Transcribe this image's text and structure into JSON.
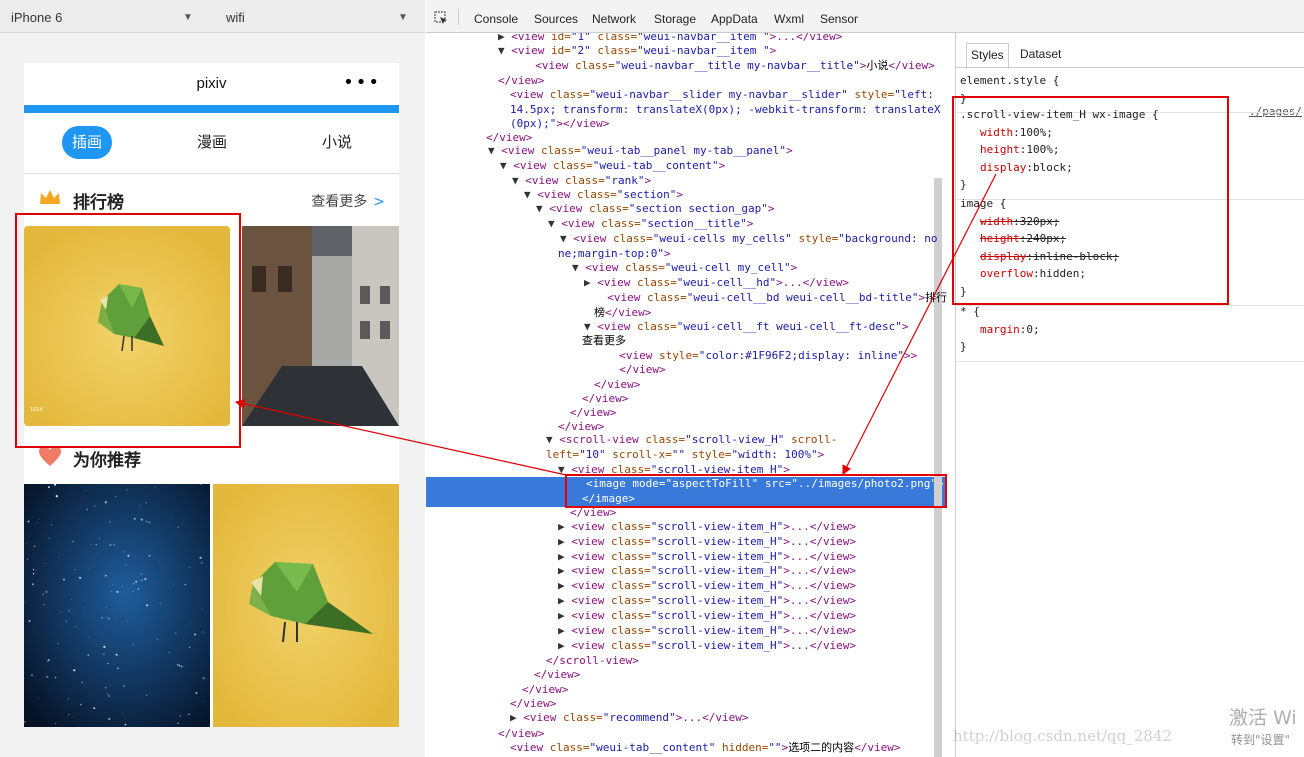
{
  "simulator": {
    "device": "iPhone 6",
    "network": "wifi"
  },
  "phone": {
    "nav_title": "pixiv",
    "menu_dots": "•••",
    "tabs": [
      "插画",
      "漫画",
      "小说"
    ],
    "active_tab": 0,
    "rank_title": "排行榜",
    "more": "查看更多",
    "more_arrow": ">",
    "recommend_title": "为你推荐",
    "accent": "#1F96F2",
    "crown_color": "#F5A623",
    "heart_color": "#F07C68",
    "tile_yellow": "#E6BE45",
    "tile_caption_small": "1024"
  },
  "devtools": {
    "tabs": [
      "Console",
      "Sources",
      "Network",
      "Storage",
      "AppData",
      "Wxml",
      "Sensor"
    ],
    "inspect_icon": "cursor-select-icon",
    "styles_tabs": [
      "Styles",
      "Dataset"
    ],
    "styles_active": 0,
    "source_link": "./pages/",
    "elements": [
      [
        {
          "t": "tri",
          "v": "▶ "
        },
        {
          "t": "tag",
          "v": "<view "
        },
        {
          "t": "an",
          "v": "id="
        },
        {
          "t": "av",
          "v": "\"1\" "
        },
        {
          "t": "an",
          "v": "class="
        },
        {
          "t": "av",
          "v": "\"weui-navbar__item \""
        },
        {
          "t": "tag",
          "v": ">...</view>"
        }
      ],
      [
        {
          "t": "tri",
          "v": "▼ "
        },
        {
          "t": "tag",
          "v": "<view "
        },
        {
          "t": "an",
          "v": "id="
        },
        {
          "t": "av",
          "v": "\"2\" "
        },
        {
          "t": "an",
          "v": "class="
        },
        {
          "t": "av",
          "v": "\"weui-navbar__item \""
        },
        {
          "t": "tag",
          "v": ">"
        }
      ],
      [
        {
          "t": "tag",
          "v": "  <view "
        },
        {
          "t": "an",
          "v": "class="
        },
        {
          "t": "av",
          "v": "\"weui-navbar__title my-navbar__title\""
        },
        {
          "t": "tag",
          "v": ">"
        },
        {
          "t": "tx",
          "v": "小说"
        },
        {
          "t": "tag",
          "v": "</view>"
        }
      ],
      [
        {
          "t": "tag",
          "v": "</view>"
        }
      ],
      [
        {
          "t": "tag",
          "v": "<view "
        },
        {
          "t": "an",
          "v": "class="
        },
        {
          "t": "av",
          "v": "\"weui-navbar__slider my-navbar__slider\" "
        },
        {
          "t": "an",
          "v": "style="
        },
        {
          "t": "av",
          "v": "\"left:"
        }
      ],
      [
        {
          "t": "av",
          "v": "14.5px; transform: translateX(0px); -webkit-transform: translateX"
        }
      ],
      [
        {
          "t": "av",
          "v": "(0px);\""
        },
        {
          "t": "tag",
          "v": "></view>"
        }
      ],
      [
        {
          "t": "tag",
          "v": "</view>"
        }
      ],
      [
        {
          "t": "tri",
          "v": "▼ "
        },
        {
          "t": "tag",
          "v": "<view "
        },
        {
          "t": "an",
          "v": "class="
        },
        {
          "t": "av",
          "v": "\"weui-tab__panel my-tab__panel\""
        },
        {
          "t": "tag",
          "v": ">"
        }
      ],
      [
        {
          "t": "tri",
          "v": "▼ "
        },
        {
          "t": "tag",
          "v": "<view "
        },
        {
          "t": "an",
          "v": "class="
        },
        {
          "t": "av",
          "v": "\"weui-tab__content\""
        },
        {
          "t": "tag",
          "v": ">"
        }
      ],
      [
        {
          "t": "tri",
          "v": "▼ "
        },
        {
          "t": "tag",
          "v": "<view "
        },
        {
          "t": "an",
          "v": "class="
        },
        {
          "t": "av",
          "v": "\"rank\""
        },
        {
          "t": "tag",
          "v": ">"
        }
      ],
      [
        {
          "t": "tri",
          "v": "▼ "
        },
        {
          "t": "tag",
          "v": "<view "
        },
        {
          "t": "an",
          "v": "class="
        },
        {
          "t": "av",
          "v": "\"section\""
        },
        {
          "t": "tag",
          "v": ">"
        }
      ],
      [
        {
          "t": "tri",
          "v": "▼ "
        },
        {
          "t": "tag",
          "v": "<view "
        },
        {
          "t": "an",
          "v": "class="
        },
        {
          "t": "av",
          "v": "\"section section_gap\""
        },
        {
          "t": "tag",
          "v": ">"
        }
      ],
      [
        {
          "t": "tri",
          "v": "▼ "
        },
        {
          "t": "tag",
          "v": "<view "
        },
        {
          "t": "an",
          "v": "class="
        },
        {
          "t": "av",
          "v": "\"section__title\""
        },
        {
          "t": "tag",
          "v": ">"
        }
      ],
      [
        {
          "t": "tri",
          "v": "▼ "
        },
        {
          "t": "tag",
          "v": "<view "
        },
        {
          "t": "an",
          "v": "class="
        },
        {
          "t": "av",
          "v": "\"weui-cells my_cells\" "
        },
        {
          "t": "an",
          "v": "style="
        },
        {
          "t": "av",
          "v": "\"background: no"
        }
      ],
      [
        {
          "t": "av",
          "v": "ne;margin-top:0\""
        },
        {
          "t": "tag",
          "v": ">"
        }
      ],
      [
        {
          "t": "tri",
          "v": "▼ "
        },
        {
          "t": "tag",
          "v": "<view "
        },
        {
          "t": "an",
          "v": "class="
        },
        {
          "t": "av",
          "v": "\"weui-cell my_cell\""
        },
        {
          "t": "tag",
          "v": ">"
        }
      ],
      [
        {
          "t": "tri",
          "v": "▶ "
        },
        {
          "t": "tag",
          "v": "<view "
        },
        {
          "t": "an",
          "v": "class="
        },
        {
          "t": "av",
          "v": "\"weui-cell__hd\""
        },
        {
          "t": "tag",
          "v": ">...</view>"
        }
      ],
      [
        {
          "t": "tag",
          "v": "  <view "
        },
        {
          "t": "an",
          "v": "class="
        },
        {
          "t": "av",
          "v": "\"weui-cell__bd weui-cell__bd-title\""
        },
        {
          "t": "tag",
          "v": ">"
        },
        {
          "t": "tx",
          "v": "排行"
        }
      ],
      [
        {
          "t": "tx",
          "v": "榜"
        },
        {
          "t": "tag",
          "v": "</view>"
        }
      ],
      [
        {
          "t": "tri",
          "v": "▼ "
        },
        {
          "t": "tag",
          "v": "<view "
        },
        {
          "t": "an",
          "v": "class="
        },
        {
          "t": "av",
          "v": "\"weui-cell__ft weui-cell__ft-desc\""
        },
        {
          "t": "tag",
          "v": ">"
        }
      ],
      [
        {
          "t": "tx",
          "v": "查看更多"
        }
      ],
      [
        {
          "t": "tag",
          "v": "  <view "
        },
        {
          "t": "an",
          "v": "style="
        },
        {
          "t": "av",
          "v": "\"color:#1F96F2;display: inline\""
        },
        {
          "t": "tag",
          "v": ">>"
        }
      ],
      [
        {
          "t": "tag",
          "v": "  </view>"
        }
      ],
      [
        {
          "t": "tag",
          "v": "</view>"
        }
      ],
      [
        {
          "t": "tag",
          "v": "</view>"
        }
      ],
      [
        {
          "t": "tag",
          "v": "</view>"
        }
      ],
      [
        {
          "t": "tag",
          "v": "</view>"
        }
      ],
      [
        {
          "t": "tri",
          "v": "▼ "
        },
        {
          "t": "tag",
          "v": "<scroll-view "
        },
        {
          "t": "an",
          "v": "class="
        },
        {
          "t": "av",
          "v": "\"scroll-view_H\" "
        },
        {
          "t": "an",
          "v": "scroll-"
        }
      ],
      [
        {
          "t": "an",
          "v": "left="
        },
        {
          "t": "av",
          "v": "\"10\" "
        },
        {
          "t": "an",
          "v": "scroll-x="
        },
        {
          "t": "av",
          "v": "\"\" "
        },
        {
          "t": "an",
          "v": "style="
        },
        {
          "t": "av",
          "v": "\"width: 100%\""
        },
        {
          "t": "tag",
          "v": ">"
        }
      ],
      [
        {
          "t": "tri",
          "v": "▼ "
        },
        {
          "t": "tag",
          "v": "<view "
        },
        {
          "t": "an",
          "v": "class="
        },
        {
          "t": "av",
          "v": "\"scroll-view-item_H\""
        },
        {
          "t": "tag",
          "v": ">"
        }
      ],
      [
        {
          "t": "tag",
          "v": "<image "
        },
        {
          "t": "an",
          "v": "mode="
        },
        {
          "t": "av",
          "v": "\"aspectToFill\" "
        },
        {
          "t": "an",
          "v": "src="
        },
        {
          "t": "av",
          "v": "\"../images/photo2.png\""
        },
        {
          "t": "tag",
          "v": ">"
        }
      ],
      [
        {
          "t": "tag",
          "v": "</image>"
        }
      ],
      [
        {
          "t": "tag",
          "v": "</view>"
        }
      ],
      [
        {
          "t": "tri",
          "v": "▶ "
        },
        {
          "t": "tag",
          "v": "<view "
        },
        {
          "t": "an",
          "v": "class="
        },
        {
          "t": "av",
          "v": "\"scroll-view-item_H\""
        },
        {
          "t": "tag",
          "v": ">...</view>"
        }
      ],
      [
        {
          "t": "tri",
          "v": "▶ "
        },
        {
          "t": "tag",
          "v": "<view "
        },
        {
          "t": "an",
          "v": "class="
        },
        {
          "t": "av",
          "v": "\"scroll-view-item_H\""
        },
        {
          "t": "tag",
          "v": ">...</view>"
        }
      ],
      [
        {
          "t": "tri",
          "v": "▶ "
        },
        {
          "t": "tag",
          "v": "<view "
        },
        {
          "t": "an",
          "v": "class="
        },
        {
          "t": "av",
          "v": "\"scroll-view-item_H\""
        },
        {
          "t": "tag",
          "v": ">...</view>"
        }
      ],
      [
        {
          "t": "tri",
          "v": "▶ "
        },
        {
          "t": "tag",
          "v": "<view "
        },
        {
          "t": "an",
          "v": "class="
        },
        {
          "t": "av",
          "v": "\"scroll-view-item_H\""
        },
        {
          "t": "tag",
          "v": ">...</view>"
        }
      ],
      [
        {
          "t": "tri",
          "v": "▶ "
        },
        {
          "t": "tag",
          "v": "<view "
        },
        {
          "t": "an",
          "v": "class="
        },
        {
          "t": "av",
          "v": "\"scroll-view-item_H\""
        },
        {
          "t": "tag",
          "v": ">...</view>"
        }
      ],
      [
        {
          "t": "tri",
          "v": "▶ "
        },
        {
          "t": "tag",
          "v": "<view "
        },
        {
          "t": "an",
          "v": "class="
        },
        {
          "t": "av",
          "v": "\"scroll-view-item_H\""
        },
        {
          "t": "tag",
          "v": ">...</view>"
        }
      ],
      [
        {
          "t": "tri",
          "v": "▶ "
        },
        {
          "t": "tag",
          "v": "<view "
        },
        {
          "t": "an",
          "v": "class="
        },
        {
          "t": "av",
          "v": "\"scroll-view-item_H\""
        },
        {
          "t": "tag",
          "v": ">...</view>"
        }
      ],
      [
        {
          "t": "tri",
          "v": "▶ "
        },
        {
          "t": "tag",
          "v": "<view "
        },
        {
          "t": "an",
          "v": "class="
        },
        {
          "t": "av",
          "v": "\"scroll-view-item_H\""
        },
        {
          "t": "tag",
          "v": ">...</view>"
        }
      ],
      [
        {
          "t": "tri",
          "v": "▶ "
        },
        {
          "t": "tag",
          "v": "<view "
        },
        {
          "t": "an",
          "v": "class="
        },
        {
          "t": "av",
          "v": "\"scroll-view-item_H\""
        },
        {
          "t": "tag",
          "v": ">...</view>"
        }
      ],
      [
        {
          "t": "tag",
          "v": "</scroll-view>"
        }
      ],
      [
        {
          "t": "tag",
          "v": "</view>"
        }
      ],
      [
        {
          "t": "tag",
          "v": "</view>"
        }
      ],
      [
        {
          "t": "tag",
          "v": "</view>"
        }
      ],
      [
        {
          "t": "tri",
          "v": "▶ "
        },
        {
          "t": "tag",
          "v": "<view "
        },
        {
          "t": "an",
          "v": "class="
        },
        {
          "t": "av",
          "v": "\"recommend\""
        },
        {
          "t": "tag",
          "v": ">...</view>"
        }
      ],
      [
        {
          "t": "tag",
          "v": "</view>"
        }
      ],
      [
        {
          "t": "tag",
          "v": "<view "
        },
        {
          "t": "an",
          "v": "class="
        },
        {
          "t": "av",
          "v": "\"weui-tab__content\" "
        },
        {
          "t": "an",
          "v": "hidden="
        },
        {
          "t": "av",
          "v": "\"\""
        },
        {
          "t": "tag",
          "v": ">"
        },
        {
          "t": "tx",
          "v": "选项二的内容"
        },
        {
          "t": "tag",
          "v": "</view>"
        }
      ]
    ],
    "styles": [
      {
        "lines": [
          {
            "sel": "element.style {"
          },
          {
            "sel": "}"
          }
        ]
      },
      {
        "lines": [
          {
            "sel": ".scroll-view-item_H wx-image {"
          },
          {
            "p": "width",
            "v": "100%;"
          },
          {
            "p": "height",
            "v": "100%;"
          },
          {
            "p": "display",
            "v": "block;"
          },
          {
            "sel": "}"
          }
        ]
      },
      {
        "lines": [
          {
            "sel": "image {"
          },
          {
            "p": "width",
            "v": "320px;",
            "s": true
          },
          {
            "p": "height",
            "v": "240px;",
            "s": true
          },
          {
            "p": "display",
            "v": "inline-block;",
            "s": true
          },
          {
            "p": "overflow",
            "v": "hidden;"
          },
          {
            "sel": "}"
          }
        ]
      },
      {
        "lines": [
          {
            "sel": "* {"
          },
          {
            "p": "margin",
            "v": "0;"
          },
          {
            "sel": "}"
          }
        ]
      }
    ]
  },
  "annotation_color": "#e00000",
  "watermark": "http://blog.csdn.net/qq_2842",
  "activation_title": "激活 Wi",
  "activation_sub": "转到\"设置\""
}
